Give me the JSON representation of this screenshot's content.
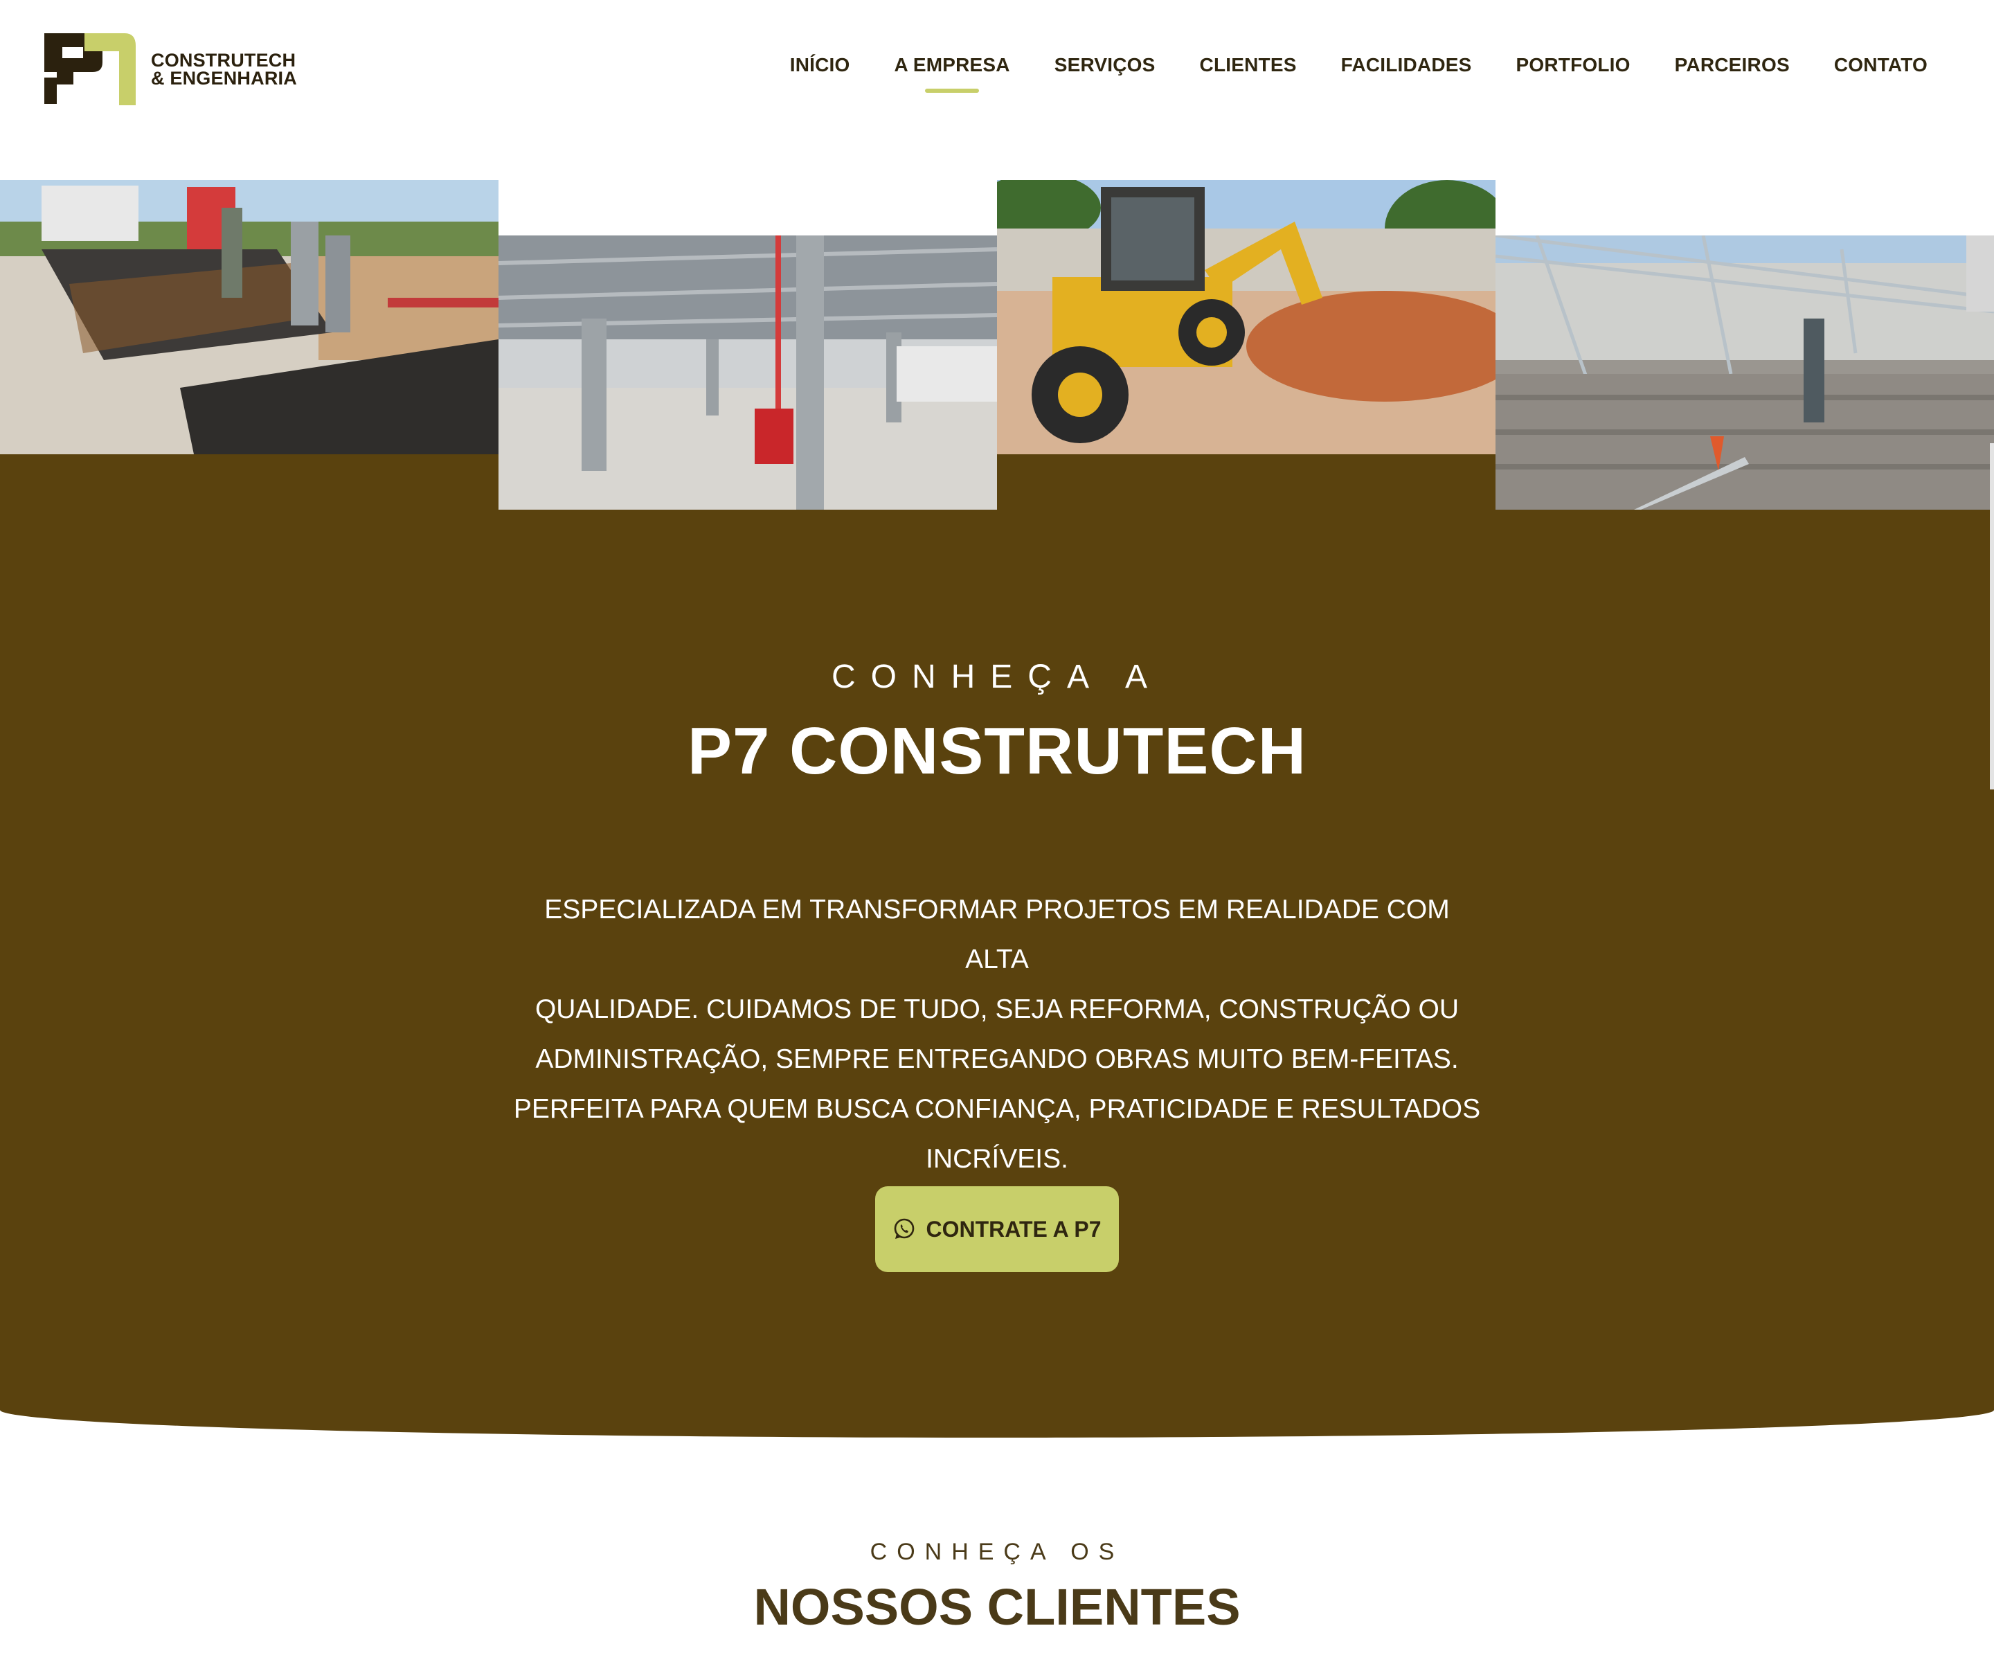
{
  "brand": {
    "name_line1": "CONSTRUTECH",
    "name_line2": "& ENGENHARIA",
    "colors": {
      "primary": "#5a420e",
      "accent": "#c8cf6a",
      "dark": "#2b210e"
    }
  },
  "nav": {
    "items": [
      {
        "label": "INÍCIO"
      },
      {
        "label": "A EMPRESA",
        "active": true
      },
      {
        "label": "SERVIÇOS"
      },
      {
        "label": "CLIENTES"
      },
      {
        "label": "FACILIDADES"
      },
      {
        "label": "PORTFOLIO"
      },
      {
        "label": "PARCEIROS"
      },
      {
        "label": "CONTATO"
      }
    ]
  },
  "gallery": {
    "images": [
      {
        "name": "rebar-formwork-photo"
      },
      {
        "name": "warehouse-interior-photo"
      },
      {
        "name": "backhoe-loader-photo"
      },
      {
        "name": "solar-structure-photo"
      }
    ]
  },
  "about": {
    "eyebrow": "CONHEÇA A",
    "title": "P7 CONSTRUTECH",
    "lines": [
      "ESPECIALIZADA EM TRANSFORMAR PROJETOS EM REALIDADE COM ALTA",
      "QUALIDADE. CUIDAMOS DE TUDO, SEJA REFORMA, CONSTRUÇÃO OU",
      "ADMINISTRAÇÃO, SEMPRE ENTREGANDO OBRAS MUITO BEM-FEITAS.",
      "PERFEITA PARA QUEM BUSCA CONFIANÇA, PRATICIDADE E RESULTADOS",
      "INCRÍVEIS."
    ],
    "cta_label": "CONTRATE A P7",
    "cta_icon": "whatsapp-icon"
  },
  "clients": {
    "eyebrow": "CONHEÇA OS",
    "title": "NOSSOS CLIENTES"
  }
}
